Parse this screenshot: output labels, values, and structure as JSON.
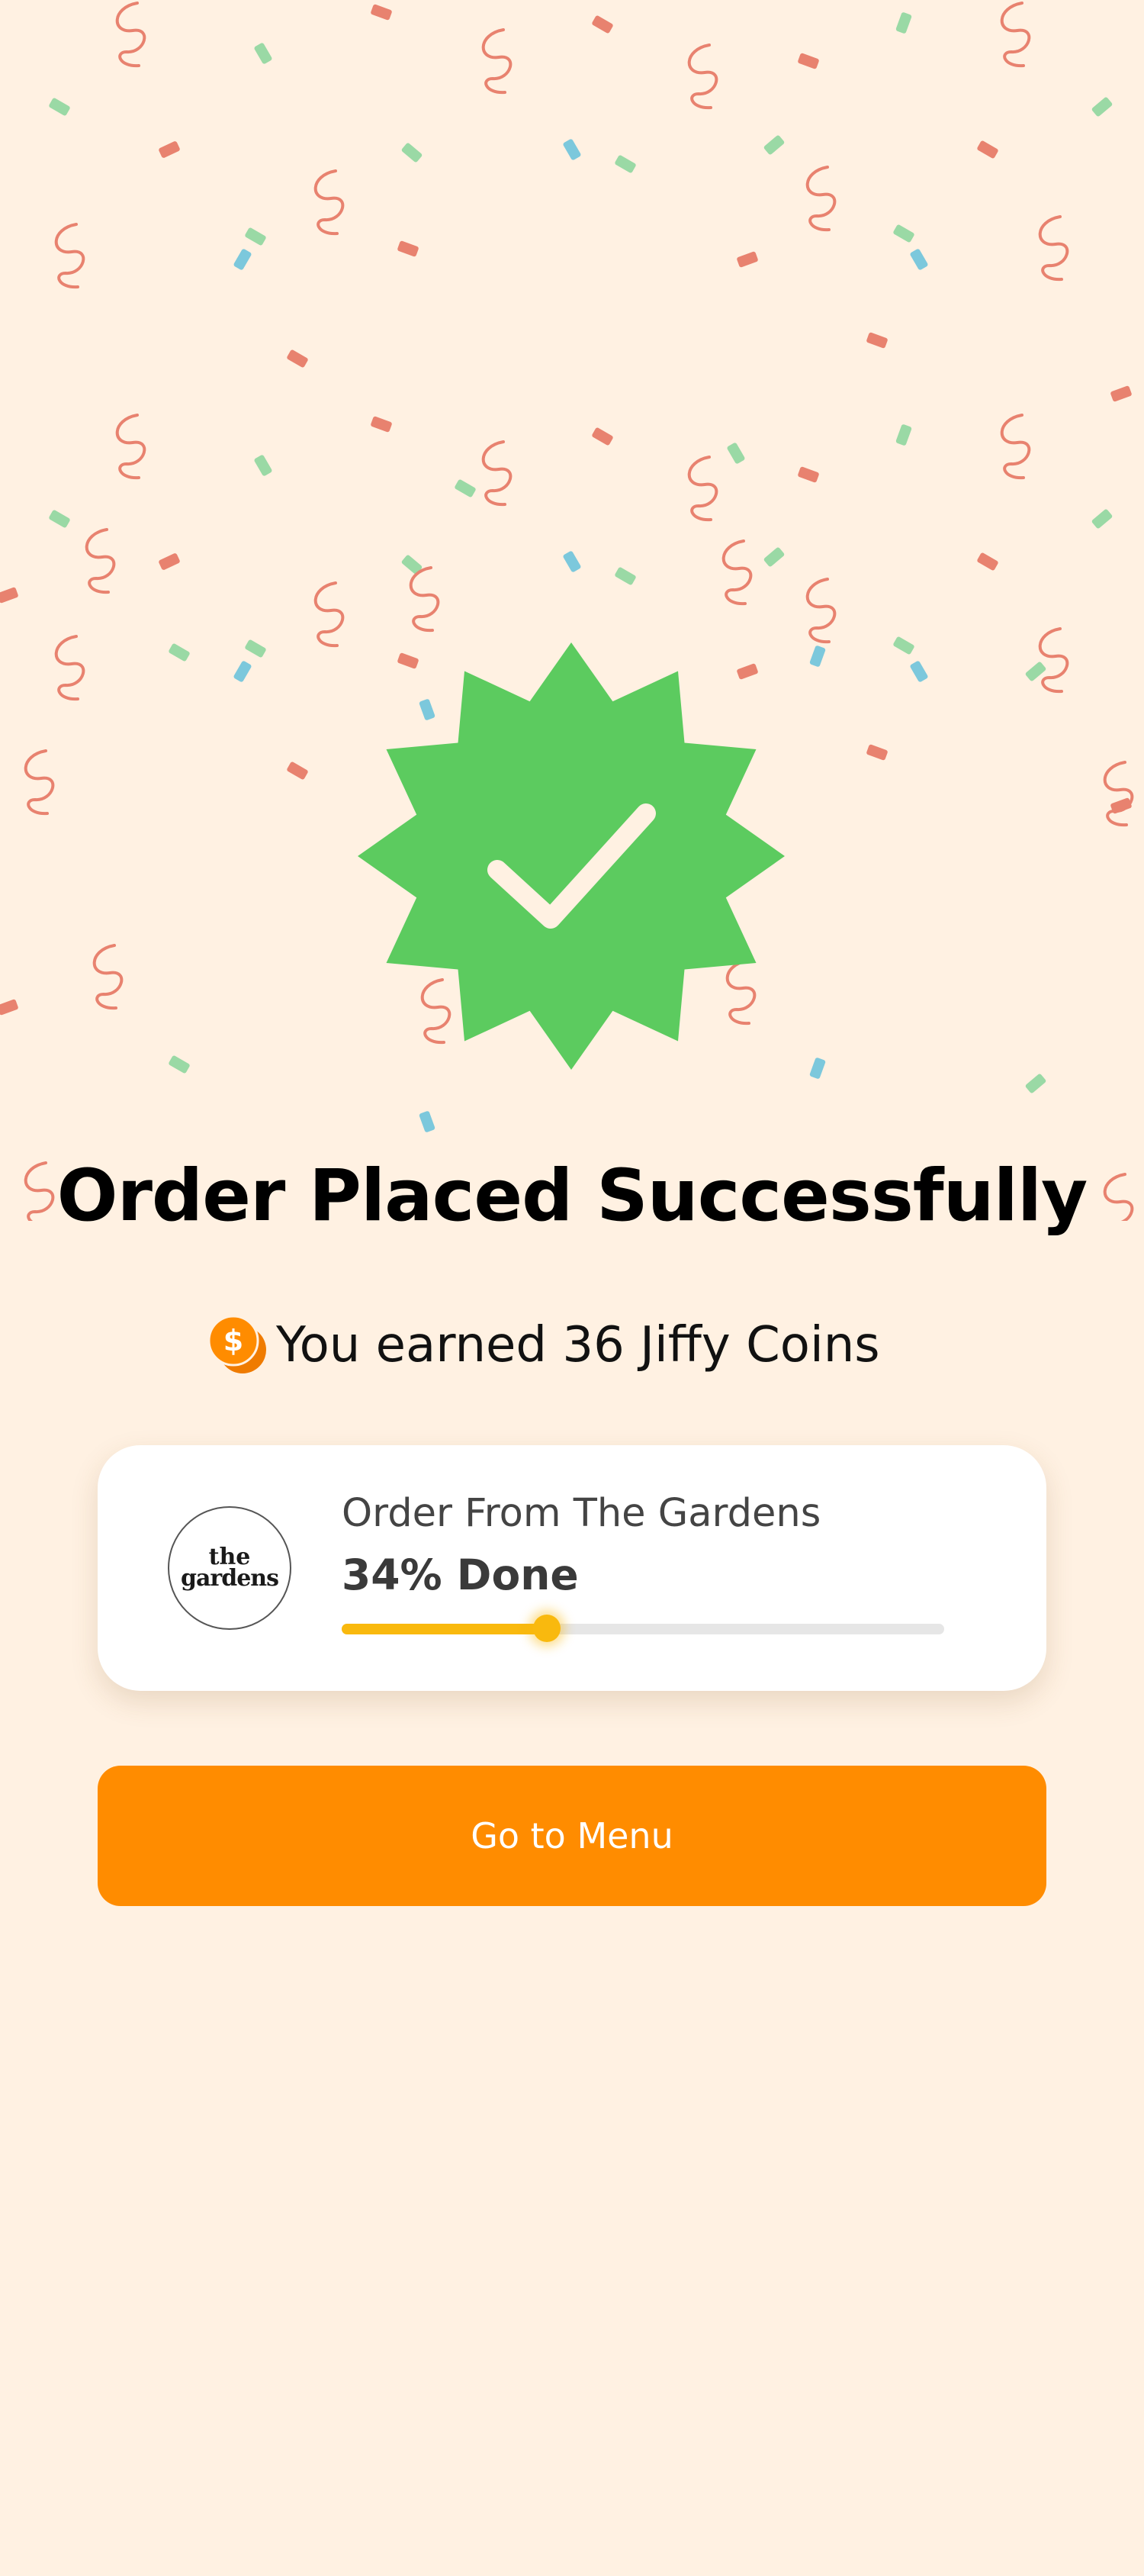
{
  "success": {
    "title": "Order Placed Successfully",
    "coins_text": "You earned 36 Jiffy Coins"
  },
  "order_card": {
    "title": "Order From The Gardens",
    "progress_label": "34% Done",
    "progress_fraction": 0.34,
    "logo_text_line1": "the",
    "logo_text_line2": "gardens"
  },
  "actions": {
    "go_to_menu_label": "Go to Menu"
  },
  "icons": {
    "badge": "check-badge-icon",
    "coin": "coin-icon"
  },
  "colors": {
    "background": "#fff1e2",
    "badge_green": "#5ccb5f",
    "accent_orange": "#ff8c00",
    "progress_yellow": "#f9b90e",
    "confetti_red": "#e8826f",
    "confetti_green": "#9ad9a5",
    "confetti_blue": "#7cc8dc"
  }
}
